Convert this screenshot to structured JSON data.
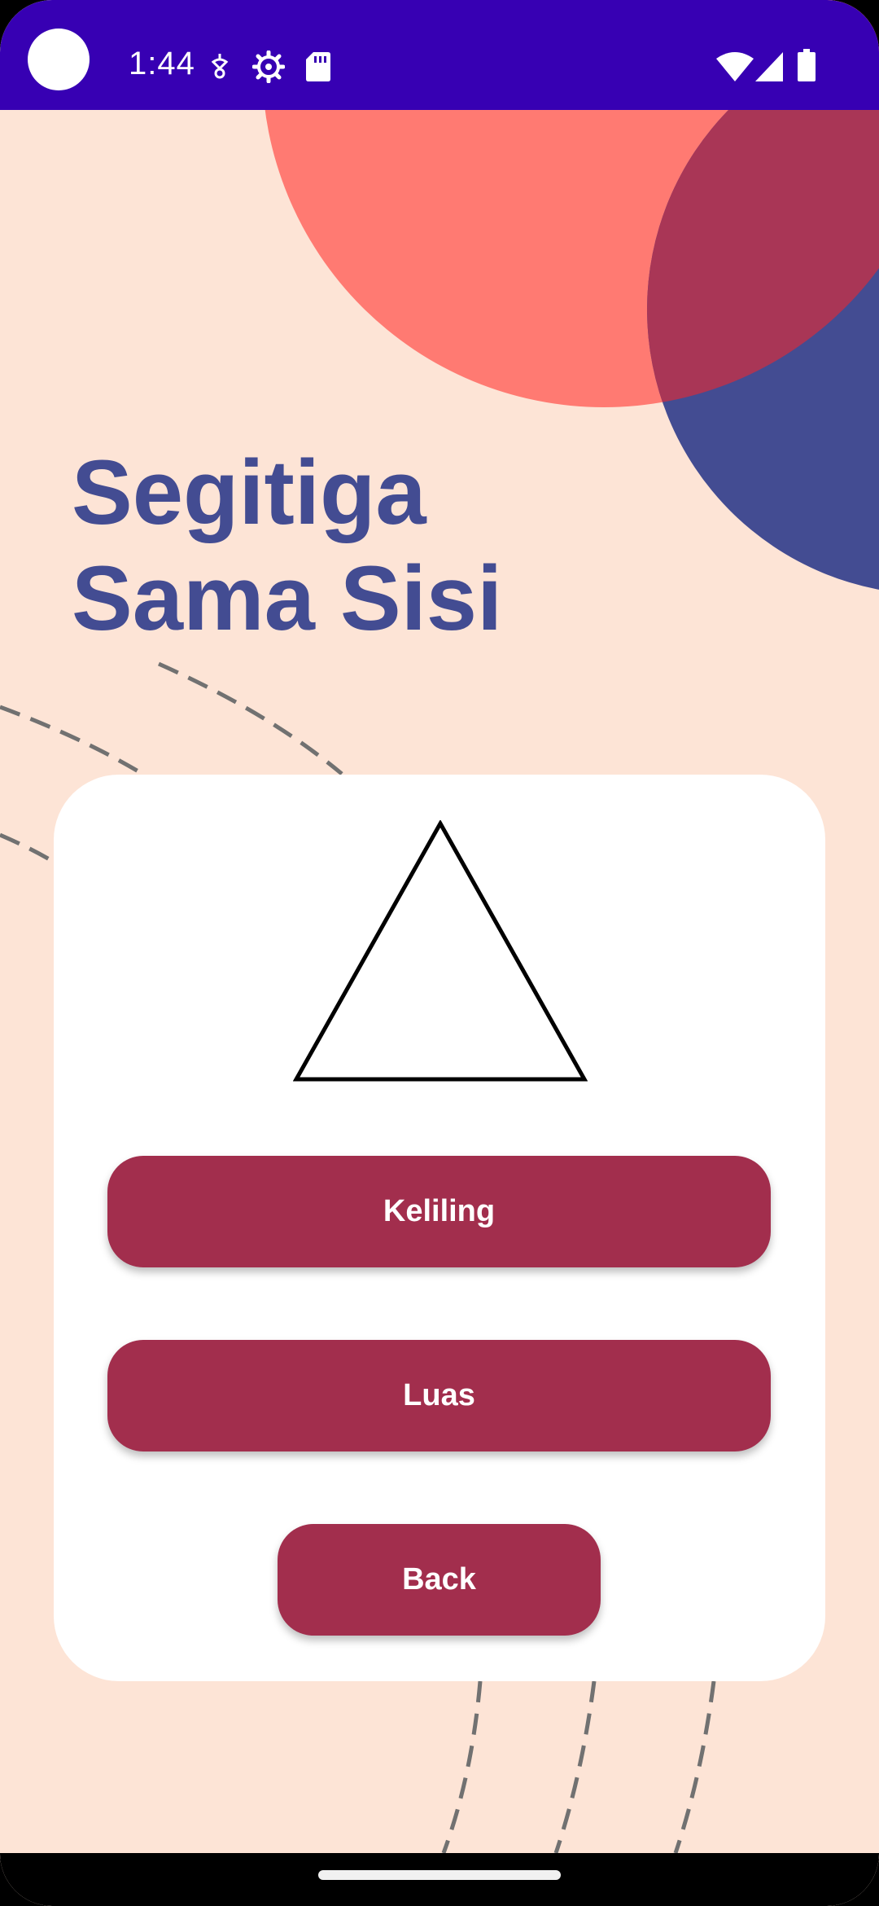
{
  "status_bar": {
    "time": "1:44",
    "left_icons": [
      "camera-hole",
      "pulse-icon",
      "gear-icon",
      "sd-card-icon"
    ],
    "right_icons": [
      "wifi-icon",
      "signal-icon",
      "battery-icon"
    ],
    "background_color": "#3700b3"
  },
  "page": {
    "title_line1": "Segitiga",
    "title_line2": "Sama Sisi",
    "background_color": "#fde4d6",
    "title_color": "#434c92"
  },
  "card": {
    "shape_icon": "equilateral-triangle-icon",
    "buttons": {
      "keliling_label": "Keliling",
      "luas_label": "Luas",
      "back_label": "Back"
    },
    "button_color": "#a22e4d"
  },
  "decorations": {
    "circle_coral_color": "#ff7a72",
    "circle_indigo_color": "#434c92",
    "circle_overlap_color": "#a93656"
  }
}
